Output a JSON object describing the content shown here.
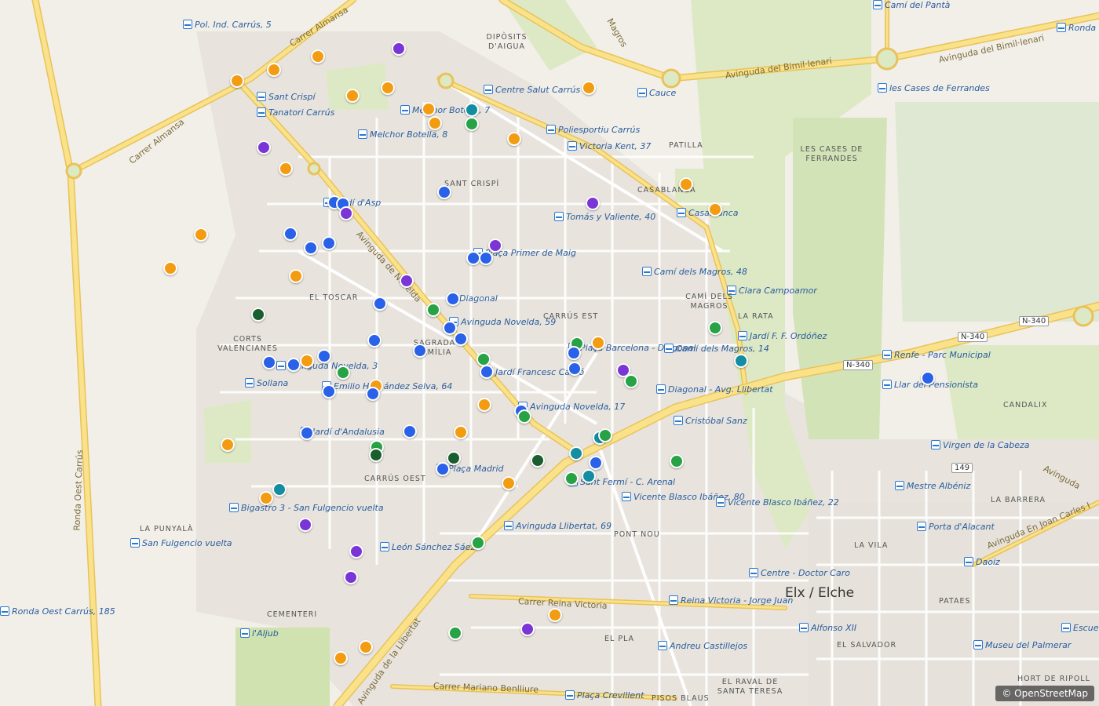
{
  "colors": {
    "orange": "#f39c12",
    "blue": "#2962e8",
    "purple": "#7b35d6",
    "green": "#27a244",
    "darkgreen": "#1a5e30",
    "teal": "#138da1",
    "road_major": "#f9e28a",
    "road_casing": "#e9c25a",
    "park": "#dde9c4",
    "background": "#f2efe9"
  },
  "stops": [
    {
      "name": "Pol. Ind. Carrús, 5"
    },
    {
      "name": "Sant Crispí"
    },
    {
      "name": "Tanatori Carrús"
    },
    {
      "name": "Melchor Botella, 8"
    },
    {
      "name": "Melchor Botella, 7"
    },
    {
      "name": "Centre Salut Carrús"
    },
    {
      "name": "Poliesportiu Carrús"
    },
    {
      "name": "Victoria Kent, 37"
    },
    {
      "name": "Cauce"
    },
    {
      "name": "Camí del Pantà"
    },
    {
      "name": "les Cases de Ferrandes"
    },
    {
      "name": "Tomás y Valiente, 40"
    },
    {
      "name": "Casablanca"
    },
    {
      "name": "Plaça Primer de Maig"
    },
    {
      "name": "Camí dels Magros, 48"
    },
    {
      "name": "Clara Campoamor"
    },
    {
      "name": "Diagonal"
    },
    {
      "name": "Avinguda Novelda, 59"
    },
    {
      "name": "Jardí d'Asp"
    },
    {
      "name": "Jardí F. F. Ordóñez"
    },
    {
      "name": "Plaça Barcelona - Diagonal"
    },
    {
      "name": "Camí dels Magros, 14"
    },
    {
      "name": "Renfe - Parc Municipal"
    },
    {
      "name": "Jardí Francesc Cantó"
    },
    {
      "name": "Avinguda Novelda, 3"
    },
    {
      "name": "Sollana"
    },
    {
      "name": "Emilio Hernández Selva, 64"
    },
    {
      "name": "Llar del Pensionista"
    },
    {
      "name": "Diagonal - Avg. Llibertat"
    },
    {
      "name": "Avinguda Novelda, 17"
    },
    {
      "name": "Cristóbal Sanz"
    },
    {
      "name": "Jardí d'Andalusia"
    },
    {
      "name": "Virgen de la Cabeza"
    },
    {
      "name": "Plaça Madrid"
    },
    {
      "name": "Sant Fermí - C. Arenal"
    },
    {
      "name": "Mestre Albéniz"
    },
    {
      "name": "Bigastro 3 - San Fulgencio vuelta"
    },
    {
      "name": "Vicente Blasco Ibáñez, 80"
    },
    {
      "name": "Vicente Blasco Ibáñez, 22"
    },
    {
      "name": "Porta d'Alacant"
    },
    {
      "name": "San Fulgencio vuelta"
    },
    {
      "name": "Avinguda Llibertat, 69"
    },
    {
      "name": "León Sánchez Sáez"
    },
    {
      "name": "Daoiz"
    },
    {
      "name": "Centre - Doctor Caro"
    },
    {
      "name": "Reina Victoria - Jorge Juan"
    },
    {
      "name": "Alfonso XII"
    },
    {
      "name": "l'Aljub"
    },
    {
      "name": "Escuelas"
    },
    {
      "name": "Andreu Castillejos"
    },
    {
      "name": "Museu del Palmerar"
    },
    {
      "name": "Plaça Crevillent"
    },
    {
      "name": "Ronda Oest Carrús, 185"
    },
    {
      "name": "Ronda"
    }
  ],
  "districts": [
    {
      "name": "DIPÒSITS D'AIGUA"
    },
    {
      "name": "SANT CRISPÍ"
    },
    {
      "name": "PATILLA"
    },
    {
      "name": "LES CASES DE FERRANDES"
    },
    {
      "name": "CASABLANCA"
    },
    {
      "name": "CAMÍ DELS MAGROS"
    },
    {
      "name": "EL TOSCAR"
    },
    {
      "name": "CARRÚS EST"
    },
    {
      "name": "LA RATA"
    },
    {
      "name": "CORTS VALENCIANES"
    },
    {
      "name": "SAGRADA FAMÍLIA"
    },
    {
      "name": "CANDALIX"
    },
    {
      "name": "CARRÚS OEST"
    },
    {
      "name": "LA BARRERA"
    },
    {
      "name": "LA PUNYALÀ"
    },
    {
      "name": "PONT NOU"
    },
    {
      "name": "LA VILA"
    },
    {
      "name": "PATAES"
    },
    {
      "name": "CEMENTERI"
    },
    {
      "name": "EL PLA"
    },
    {
      "name": "EL SALVADOR"
    },
    {
      "name": "HORT DE RIPOLL"
    },
    {
      "name": "EL RAVAL DE SANTA TERESA"
    },
    {
      "name": "PISOS BLAUS"
    }
  ],
  "streets": [
    {
      "name": "Carrer Almansa"
    },
    {
      "name": "Carrer Almansa"
    },
    {
      "name": "Avinguda del Bimil·lenari"
    },
    {
      "name": "Avinguda del Bimil·lenari"
    },
    {
      "name": "Ronda Oest Carrús"
    },
    {
      "name": "Avinguda de Novelda"
    },
    {
      "name": "Avinguda de la Llibertat"
    },
    {
      "name": "Carrer Reina Victoria"
    },
    {
      "name": "Carrer Mariano Benlliure"
    },
    {
      "name": "Avinguda En Joan Carles I"
    },
    {
      "name": "Avinguda"
    },
    {
      "name": "Magros"
    }
  ],
  "city": {
    "name": "Elx / Elche"
  },
  "shields": [
    {
      "name": "N-340"
    },
    {
      "name": "N-340"
    },
    {
      "name": "N-340"
    },
    {
      "name": "149"
    }
  ],
  "attribution": "© OpenStreetMap",
  "markers": [
    {
      "color": "purple",
      "lat": 0.069,
      "lng": 0.363
    },
    {
      "color": "orange",
      "lat": 0.08,
      "lng": 0.289
    },
    {
      "color": "orange",
      "lat": 0.099,
      "lng": 0.249
    },
    {
      "color": "orange",
      "lat": 0.114,
      "lng": 0.216
    },
    {
      "color": "orange",
      "lat": 0.124,
      "lng": 0.353
    },
    {
      "color": "orange",
      "lat": 0.136,
      "lng": 0.321
    },
    {
      "color": "orange",
      "lat": 0.154,
      "lng": 0.39
    },
    {
      "color": "teal",
      "lat": 0.156,
      "lng": 0.429
    },
    {
      "color": "orange",
      "lat": 0.124,
      "lng": 0.536
    },
    {
      "color": "orange",
      "lat": 0.174,
      "lng": 0.396
    },
    {
      "color": "green",
      "lat": 0.176,
      "lng": 0.429
    },
    {
      "color": "orange",
      "lat": 0.197,
      "lng": 0.468
    },
    {
      "color": "purple",
      "lat": 0.209,
      "lng": 0.24
    },
    {
      "color": "orange",
      "lat": 0.239,
      "lng": 0.26
    },
    {
      "color": "orange",
      "lat": 0.261,
      "lng": 0.624
    },
    {
      "color": "blue",
      "lat": 0.272,
      "lng": 0.404
    },
    {
      "color": "purple",
      "lat": 0.288,
      "lng": 0.539
    },
    {
      "color": "orange",
      "lat": 0.297,
      "lng": 0.651
    },
    {
      "color": "blue",
      "lat": 0.287,
      "lng": 0.304
    },
    {
      "color": "blue",
      "lat": 0.289,
      "lng": 0.312
    },
    {
      "color": "purple",
      "lat": 0.302,
      "lng": 0.315
    },
    {
      "color": "orange",
      "lat": 0.332,
      "lng": 0.183
    },
    {
      "color": "blue",
      "lat": 0.331,
      "lng": 0.264
    },
    {
      "color": "blue",
      "lat": 0.344,
      "lng": 0.299
    },
    {
      "color": "blue",
      "lat": 0.351,
      "lng": 0.283
    },
    {
      "color": "purple",
      "lat": 0.348,
      "lng": 0.451
    },
    {
      "color": "blue",
      "lat": 0.366,
      "lng": 0.431
    },
    {
      "color": "blue",
      "lat": 0.366,
      "lng": 0.442
    },
    {
      "color": "orange",
      "lat": 0.38,
      "lng": 0.155
    },
    {
      "color": "orange",
      "lat": 0.391,
      "lng": 0.269
    },
    {
      "color": "purple",
      "lat": 0.398,
      "lng": 0.37
    },
    {
      "color": "blue",
      "lat": 0.423,
      "lng": 0.412
    },
    {
      "color": "blue",
      "lat": 0.43,
      "lng": 0.346
    },
    {
      "color": "green",
      "lat": 0.439,
      "lng": 0.394
    },
    {
      "color": "darkgreen",
      "lat": 0.446,
      "lng": 0.235
    },
    {
      "color": "blue",
      "lat": 0.464,
      "lng": 0.409
    },
    {
      "color": "green",
      "lat": 0.464,
      "lng": 0.651
    },
    {
      "color": "blue",
      "lat": 0.48,
      "lng": 0.419
    },
    {
      "color": "blue",
      "lat": 0.482,
      "lng": 0.341
    },
    {
      "color": "blue",
      "lat": 0.497,
      "lng": 0.382
    },
    {
      "color": "green",
      "lat": 0.487,
      "lng": 0.525
    },
    {
      "color": "orange",
      "lat": 0.486,
      "lng": 0.544
    },
    {
      "color": "blue",
      "lat": 0.5,
      "lng": 0.522
    },
    {
      "color": "teal",
      "lat": 0.511,
      "lng": 0.674
    },
    {
      "color": "blue",
      "lat": 0.504,
      "lng": 0.295
    },
    {
      "color": "blue",
      "lat": 0.513,
      "lng": 0.245
    },
    {
      "color": "blue",
      "lat": 0.517,
      "lng": 0.267
    },
    {
      "color": "orange",
      "lat": 0.511,
      "lng": 0.279
    },
    {
      "color": "green",
      "lat": 0.509,
      "lng": 0.44
    },
    {
      "color": "blue",
      "lat": 0.522,
      "lng": 0.523
    },
    {
      "color": "purple",
      "lat": 0.524,
      "lng": 0.567
    },
    {
      "color": "blue",
      "lat": 0.527,
      "lng": 0.443
    },
    {
      "color": "green",
      "lat": 0.528,
      "lng": 0.312
    },
    {
      "color": "blue",
      "lat": 0.536,
      "lng": 0.844
    },
    {
      "color": "green",
      "lat": 0.54,
      "lng": 0.574
    },
    {
      "color": "orange",
      "lat": 0.547,
      "lng": 0.342
    },
    {
      "color": "blue",
      "lat": 0.554,
      "lng": 0.299
    },
    {
      "color": "blue",
      "lat": 0.558,
      "lng": 0.339
    },
    {
      "color": "orange",
      "lat": 0.573,
      "lng": 0.441
    },
    {
      "color": "blue",
      "lat": 0.582,
      "lng": 0.474
    },
    {
      "color": "green",
      "lat": 0.59,
      "lng": 0.477
    },
    {
      "color": "blue",
      "lat": 0.613,
      "lng": 0.279
    },
    {
      "color": "blue",
      "lat": 0.611,
      "lng": 0.373
    },
    {
      "color": "orange",
      "lat": 0.612,
      "lng": 0.419
    },
    {
      "color": "teal",
      "lat": 0.62,
      "lng": 0.546
    },
    {
      "color": "green",
      "lat": 0.617,
      "lng": 0.551
    },
    {
      "color": "orange",
      "lat": 0.63,
      "lng": 0.207
    },
    {
      "color": "green",
      "lat": 0.633,
      "lng": 0.343
    },
    {
      "color": "darkgreen",
      "lat": 0.644,
      "lng": 0.342
    },
    {
      "color": "green",
      "lat": 0.653,
      "lng": 0.616
    },
    {
      "color": "darkgreen",
      "lat": 0.649,
      "lng": 0.413
    },
    {
      "color": "darkgreen",
      "lat": 0.652,
      "lng": 0.489
    },
    {
      "color": "teal",
      "lat": 0.642,
      "lng": 0.524
    },
    {
      "color": "blue",
      "lat": 0.656,
      "lng": 0.542
    },
    {
      "color": "blue",
      "lat": 0.664,
      "lng": 0.403
    },
    {
      "color": "green",
      "lat": 0.678,
      "lng": 0.52
    },
    {
      "color": "teal",
      "lat": 0.674,
      "lng": 0.536
    },
    {
      "color": "orange",
      "lat": 0.684,
      "lng": 0.463
    },
    {
      "color": "teal",
      "lat": 0.693,
      "lng": 0.254
    },
    {
      "color": "orange",
      "lat": 0.706,
      "lng": 0.242
    },
    {
      "color": "purple",
      "lat": 0.743,
      "lng": 0.278
    },
    {
      "color": "green",
      "lat": 0.769,
      "lng": 0.435
    },
    {
      "color": "purple",
      "lat": 0.781,
      "lng": 0.324
    },
    {
      "color": "purple",
      "lat": 0.818,
      "lng": 0.319
    },
    {
      "color": "orange",
      "lat": 0.871,
      "lng": 0.505
    },
    {
      "color": "purple",
      "lat": 0.891,
      "lng": 0.48
    },
    {
      "color": "green",
      "lat": 0.897,
      "lng": 0.414
    },
    {
      "color": "orange",
      "lat": 0.917,
      "lng": 0.333
    },
    {
      "color": "orange",
      "lat": 0.932,
      "lng": 0.31
    }
  ]
}
